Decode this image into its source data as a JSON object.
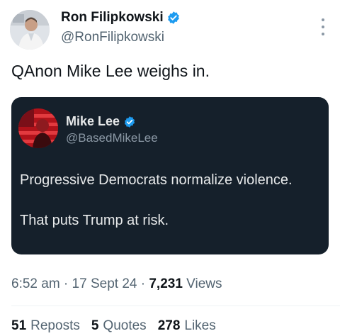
{
  "author": {
    "name": "Ron Filipkowski",
    "handle": "@RonFilipkowski",
    "verified": true
  },
  "tweet": {
    "text": "QAnon Mike Lee weighs in."
  },
  "quoted": {
    "name": "Mike Lee",
    "handle": "@BasedMikeLee",
    "verified": true,
    "lines": [
      "Progressive Democrats normalize violence.",
      "That puts Trump at risk."
    ]
  },
  "meta": {
    "time": "6:52 am",
    "sep1": " · ",
    "date": "17 Sept 24",
    "sep2": " · ",
    "views_count": "7,231",
    "views_label": " Views"
  },
  "stats": {
    "reposts_count": "51",
    "reposts_label": "Reposts",
    "quotes_count": "5",
    "quotes_label": "Quotes",
    "likes_count": "278",
    "likes_label": "Likes"
  },
  "colors": {
    "verified_badge": "#1d9bf0",
    "quote_background": "#15202b",
    "secondary_text": "#536471"
  },
  "icons": {
    "verified": "verified-badge-icon",
    "more": "more-options-icon"
  }
}
